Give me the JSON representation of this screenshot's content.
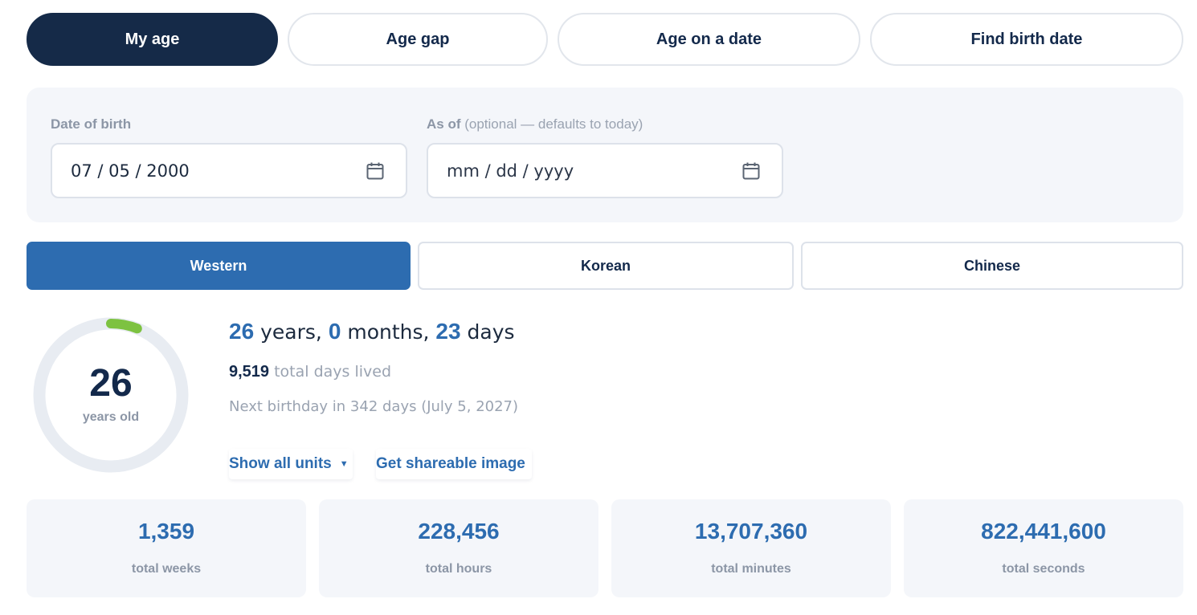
{
  "mode_tabs": [
    {
      "label": "My age",
      "active": true
    },
    {
      "label": "Age gap",
      "active": false
    },
    {
      "label": "Age on a date",
      "active": false
    },
    {
      "label": "Find birth date",
      "active": false
    }
  ],
  "inputs": {
    "dob_label": "Date of birth",
    "dob_value": "07 / 05 / 2000",
    "asof_label": "As of",
    "asof_hint": "(optional — defaults to today)",
    "asof_placeholder": "mm / dd / yyyy"
  },
  "calendar_tabs": [
    {
      "label": "Western",
      "active": true
    },
    {
      "label": "Korean",
      "active": false
    },
    {
      "label": "Chinese",
      "active": false
    }
  ],
  "result": {
    "age_years": "26",
    "ring_caption": "years old",
    "years_progress_fraction": 0.06,
    "years_num": "26",
    "years_word": "years,",
    "months_num": "0",
    "months_word": "months,",
    "days_num": "23",
    "days_word": "days",
    "total_days_num": "9,519",
    "total_days_text": "total days lived",
    "next_birthday": "Next birthday in 342 days (July 5, 2027)"
  },
  "actions": {
    "show_all_units": "Show all units",
    "get_shareable": "Get shareable image"
  },
  "stats": [
    {
      "value": "1,359",
      "label": "total weeks"
    },
    {
      "value": "228,456",
      "label": "total hours"
    },
    {
      "value": "13,707,360",
      "label": "total minutes"
    },
    {
      "value": "822,441,600",
      "label": "total seconds"
    }
  ],
  "colors": {
    "navy": "#152a48",
    "accent_blue": "#2d6cb0",
    "ring_track": "#e8ecf2",
    "ring_progress": "#7dc241"
  }
}
